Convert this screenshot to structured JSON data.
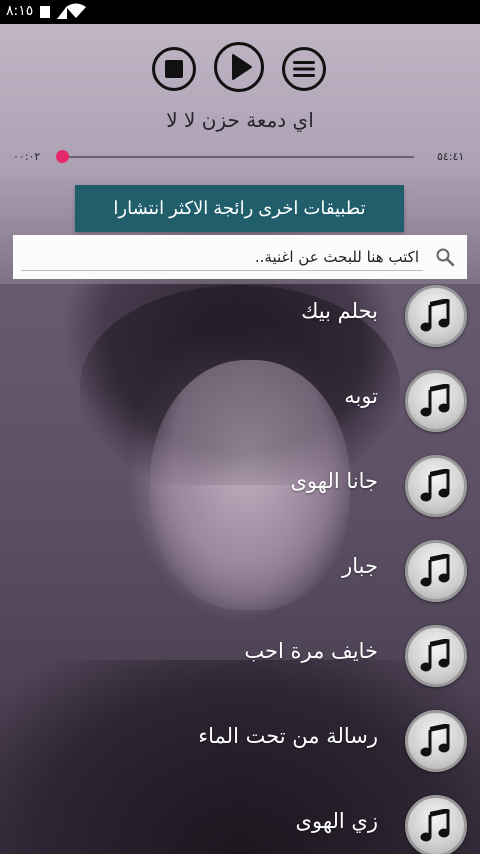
{
  "status_bar": {
    "time": "٨:١٥"
  },
  "player": {
    "title": "اي دمعة حزن لا لا",
    "current_time": "٠٠:٠٢",
    "total_time": "٥٤:٤١",
    "progress": 0.01
  },
  "promo": {
    "label": "تطبيقات اخرى رائجة الاكثر انتشارا"
  },
  "search": {
    "placeholder": "اكتب هنا للبحث عن اغنية.."
  },
  "songs": [
    {
      "title": "بحلم بيك"
    },
    {
      "title": "توبه"
    },
    {
      "title": "جانا الهوى"
    },
    {
      "title": "جبار"
    },
    {
      "title": "خايف مرة احب"
    },
    {
      "title": "رسالة من تحت الماء"
    },
    {
      "title": "زي الهوى"
    }
  ],
  "colors": {
    "promo_bg": "#1f5e6a",
    "progress_thumb": "#e6286b"
  },
  "icons": {
    "menu": "menu-icon",
    "play": "play-icon",
    "stop": "stop-icon",
    "search": "search-icon",
    "song": "music-note-icon"
  }
}
